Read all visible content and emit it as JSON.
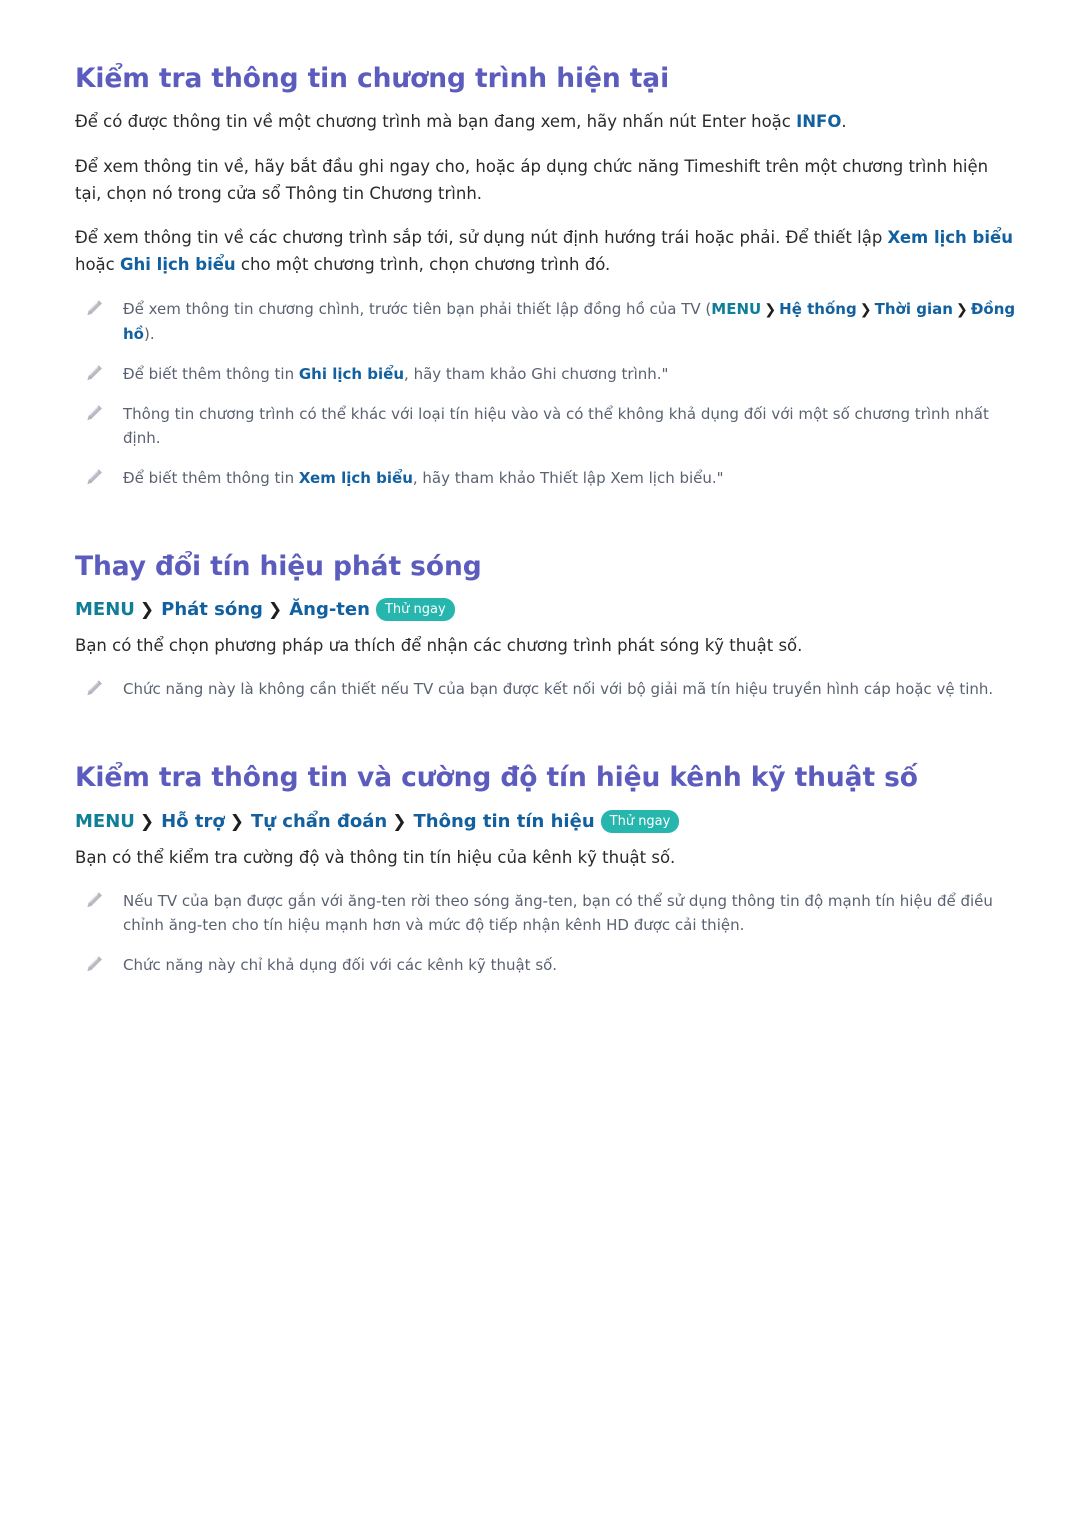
{
  "document": {
    "language": "vi",
    "colors": {
      "heading": "#5c5cbe",
      "term_blue": "#12609f",
      "term_teal": "#0f7e96",
      "badge_teal": "#26b6ae",
      "body_text": "#2a2a2a",
      "note_text": "#5a6272",
      "background": "#ffffff"
    },
    "icons": {
      "note_bullet": "pencil-icon",
      "breadcrumb_separator": "chevron-right-icon"
    }
  },
  "sections": [
    {
      "id": "current-program-info",
      "title": "Kiểm tra thông tin chương trình hiện tại",
      "paragraphs": [
        {
          "id": "p1",
          "parts": [
            {
              "type": "text",
              "value": "Để có được thông tin về một chương trình mà bạn đang xem, hãy nhấn nút Enter hoặc "
            },
            {
              "type": "term",
              "value": "INFO"
            },
            {
              "type": "text",
              "value": "."
            }
          ]
        },
        {
          "id": "p2",
          "parts": [
            {
              "type": "text",
              "value": "Để xem thông tin về, hãy bắt đầu ghi ngay cho, hoặc áp dụng chức năng Timeshift trên một chương trình hiện tại, chọn nó trong cửa sổ Thông tin Chương trình."
            }
          ]
        },
        {
          "id": "p3",
          "parts": [
            {
              "type": "text",
              "value": "Để xem thông tin về các chương trình sắp tới, sử dụng nút định hướng trái hoặc phải. Để thiết lập "
            },
            {
              "type": "term",
              "value": "Xem lịch biểu"
            },
            {
              "type": "text",
              "value": " hoặc "
            },
            {
              "type": "term",
              "value": "Ghi lịch biểu"
            },
            {
              "type": "text",
              "value": " cho một chương trình, chọn chương trình đó."
            }
          ]
        }
      ],
      "notes": [
        {
          "id": "note-1",
          "parts": [
            {
              "type": "text",
              "value": "Để xem thông tin chương chình, trước tiên bạn phải thiết lập đồng hồ của TV ("
            },
            {
              "type": "term-teal",
              "value": "MENU"
            },
            {
              "type": "chevron",
              "value": "❯"
            },
            {
              "type": "term",
              "value": "Hệ thống"
            },
            {
              "type": "chevron",
              "value": "❯"
            },
            {
              "type": "term",
              "value": "Thời gian"
            },
            {
              "type": "chevron",
              "value": "❯"
            },
            {
              "type": "term",
              "value": "Đồng hồ"
            },
            {
              "type": "text",
              "value": ")."
            }
          ]
        },
        {
          "id": "note-2",
          "parts": [
            {
              "type": "text",
              "value": "Để biết thêm thông tin "
            },
            {
              "type": "term",
              "value": "Ghi lịch biểu"
            },
            {
              "type": "text",
              "value": ", hãy tham khảo Ghi chương trình.\""
            }
          ]
        },
        {
          "id": "note-3",
          "parts": [
            {
              "type": "text",
              "value": "Thông tin chương trình có thể khác với loại tín hiệu vào và có thể không khả dụng đối với một số chương trình nhất định."
            }
          ]
        },
        {
          "id": "note-4",
          "parts": [
            {
              "type": "text",
              "value": "Để biết thêm thông tin "
            },
            {
              "type": "term",
              "value": "Xem lịch biểu"
            },
            {
              "type": "text",
              "value": ", hãy tham khảo Thiết lập Xem lịch biểu.\""
            }
          ]
        }
      ]
    },
    {
      "id": "change-broadcast-signal",
      "title": "Thay đổi tín hiệu phát sóng",
      "breadcrumb": {
        "crumbs": [
          {
            "label": "MENU",
            "style": "teal"
          },
          {
            "label": "Phát sóng",
            "style": "blue"
          },
          {
            "label": "Ăng-ten",
            "style": "blue"
          }
        ],
        "separator": "❯",
        "badge": "Thử ngay"
      },
      "paragraphs": [
        {
          "id": "p1",
          "parts": [
            {
              "type": "text",
              "value": "Bạn có thể chọn phương pháp ưa thích để nhận các chương trình phát sóng kỹ thuật số."
            }
          ]
        }
      ],
      "notes": [
        {
          "id": "note-1",
          "parts": [
            {
              "type": "text",
              "value": "Chức năng này là không cần thiết nếu TV của bạn được kết nối với bộ giải mã tín hiệu truyền hình cáp hoặc vệ tinh."
            }
          ]
        }
      ]
    },
    {
      "id": "digital-channel-signal-info",
      "title": "Kiểm tra thông tin và cường độ tín hiệu kênh kỹ thuật số",
      "breadcrumb": {
        "crumbs": [
          {
            "label": "MENU",
            "style": "teal"
          },
          {
            "label": "Hỗ trợ",
            "style": "blue"
          },
          {
            "label": "Tự chẩn đoán",
            "style": "blue"
          },
          {
            "label": "Thông tin tín hiệu",
            "style": "blue"
          }
        ],
        "separator": "❯",
        "badge": "Thử ngay"
      },
      "paragraphs": [
        {
          "id": "p1",
          "parts": [
            {
              "type": "text",
              "value": "Bạn có thể kiểm tra cường độ và thông tin tín hiệu của kênh kỹ thuật số."
            }
          ]
        }
      ],
      "notes": [
        {
          "id": "note-1",
          "parts": [
            {
              "type": "text",
              "value": "Nếu TV của bạn được gắn với ăng-ten rời theo sóng ăng-ten, bạn có thể sử dụng thông tin độ mạnh tín hiệu để điều chỉnh ăng-ten cho tín hiệu mạnh hơn và mức độ tiếp nhận kênh HD được cải thiện."
            }
          ]
        },
        {
          "id": "note-2",
          "parts": [
            {
              "type": "text",
              "value": "Chức năng này chỉ khả dụng đối với các kênh kỹ thuật số."
            }
          ]
        }
      ]
    }
  ]
}
